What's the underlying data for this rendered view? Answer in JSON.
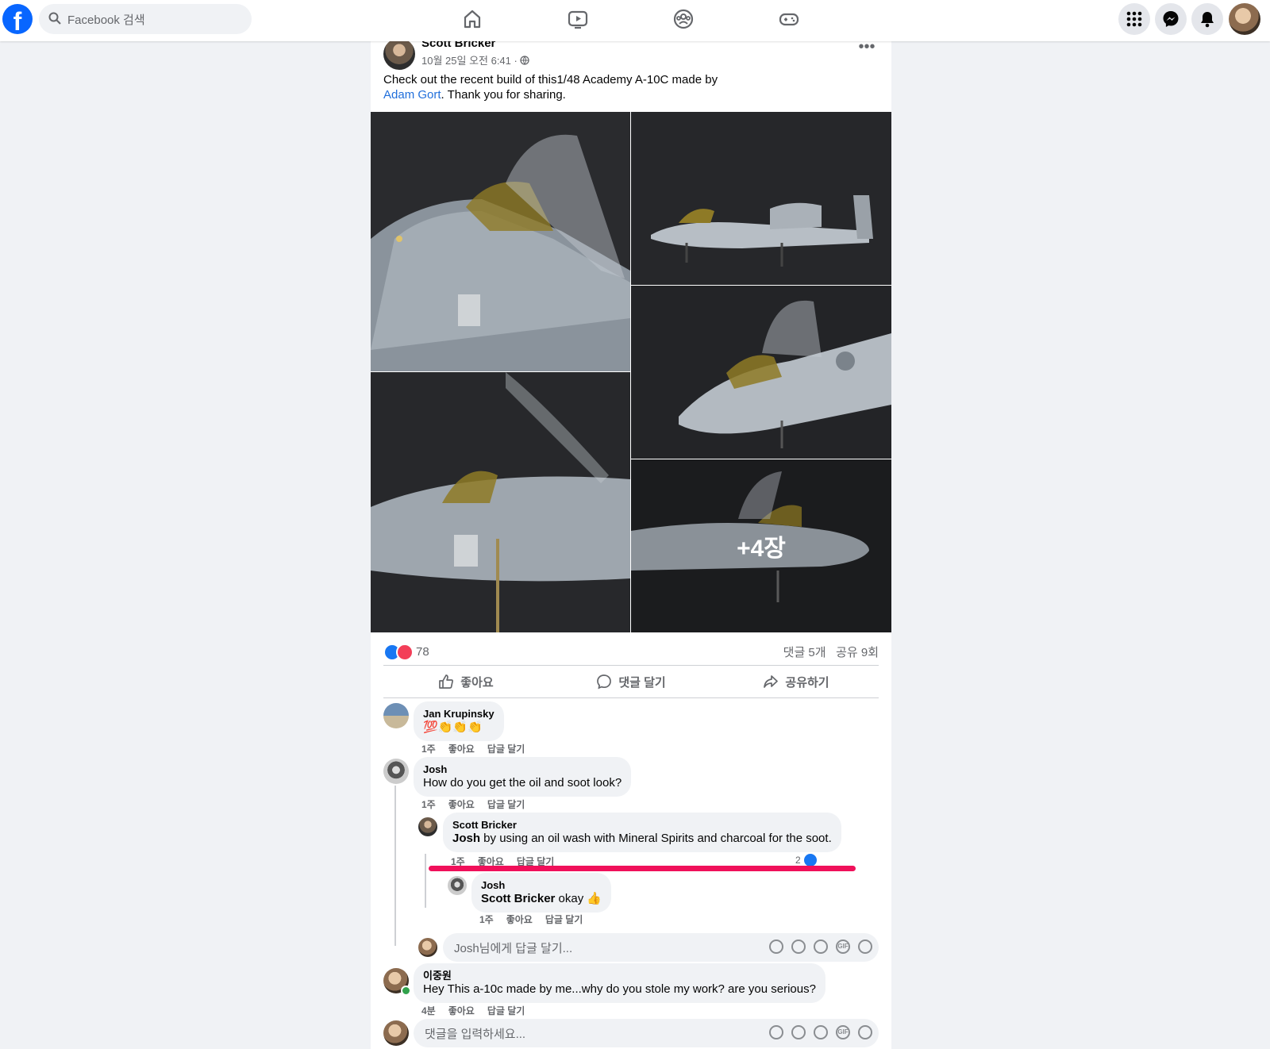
{
  "topbar": {
    "logo": "f",
    "search_placeholder": "Facebook 검색",
    "nav_icons": [
      "home-icon",
      "watch-icon",
      "groups-icon",
      "gaming-icon"
    ],
    "right_icons": [
      "menu-grid-icon",
      "messenger-icon",
      "notifications-icon"
    ]
  },
  "post": {
    "author": "Scott Bricker",
    "meta": "10월 25일 오전 6:41 · ",
    "text_before": "Check out the recent build of this1/48 Academy A-10C made by",
    "mention": "Adam Gort",
    "text_after": ".  Thank you for sharing.",
    "more_photos_label": "+4장",
    "reaction_count": "78",
    "comments_count": "댓글 5개",
    "shares_count": "공유 9회",
    "actions": {
      "like": "좋아요",
      "comment": "댓글 달기",
      "share": "공유하기"
    }
  },
  "comments": [
    {
      "name": "Jan Krupinsky",
      "text": "💯👏👏👏",
      "time": "1주",
      "like": "좋아요",
      "reply": "답글 달기"
    },
    {
      "name": "Josh",
      "text": "How do you get the oil and soot look?",
      "time": "1주",
      "like": "좋아요",
      "reply": "답글 달기",
      "replies": [
        {
          "name": "Scott Bricker",
          "mention": "Josh",
          "text": " by using an oil wash with Mineral Spirits and charcoal for the soot.",
          "time": "1주",
          "like": "좋아요",
          "reply": "답글 달기",
          "like_count": "2"
        },
        {
          "name": "Josh",
          "mention": "Scott Bricker",
          "text": " okay 👍",
          "time": "1주",
          "like": "좋아요",
          "reply": "답글 달기"
        }
      ],
      "reply_placeholder": "Josh님에게 답글 달기..."
    },
    {
      "name": "이중원",
      "text": "Hey This a-10c made by me...why do you stole my work? are you serious?",
      "time": "4분",
      "like": "좋아요",
      "reply": "답글 달기"
    }
  ],
  "comment_placeholder": "댓글을 입력하세요...",
  "colors": {
    "brand": "#0866ff",
    "link": "#216fdb",
    "highlight": "#f0105a"
  }
}
